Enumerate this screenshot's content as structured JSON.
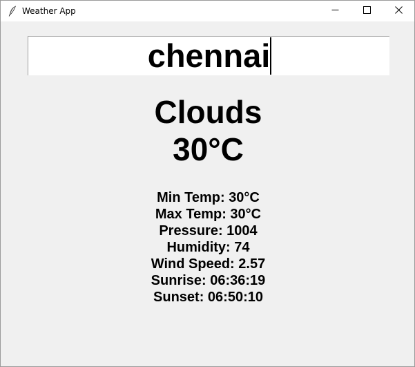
{
  "window": {
    "title": "Weather App",
    "icons": {
      "app": "feather-icon",
      "minimize": "minimize-icon",
      "maximize": "maximize-icon",
      "close": "close-icon"
    }
  },
  "search": {
    "value": "chennai"
  },
  "weather": {
    "condition": "Clouds",
    "temperature": "30°C",
    "details": {
      "min_temp": "Min Temp: 30°C",
      "max_temp": "Max Temp: 30°C",
      "pressure": "Pressure: 1004",
      "humidity": "Humidity: 74",
      "wind_speed": "Wind Speed: 2.57",
      "sunrise": "Sunrise: 06:36:19",
      "sunset": "Sunset: 06:50:10"
    }
  }
}
